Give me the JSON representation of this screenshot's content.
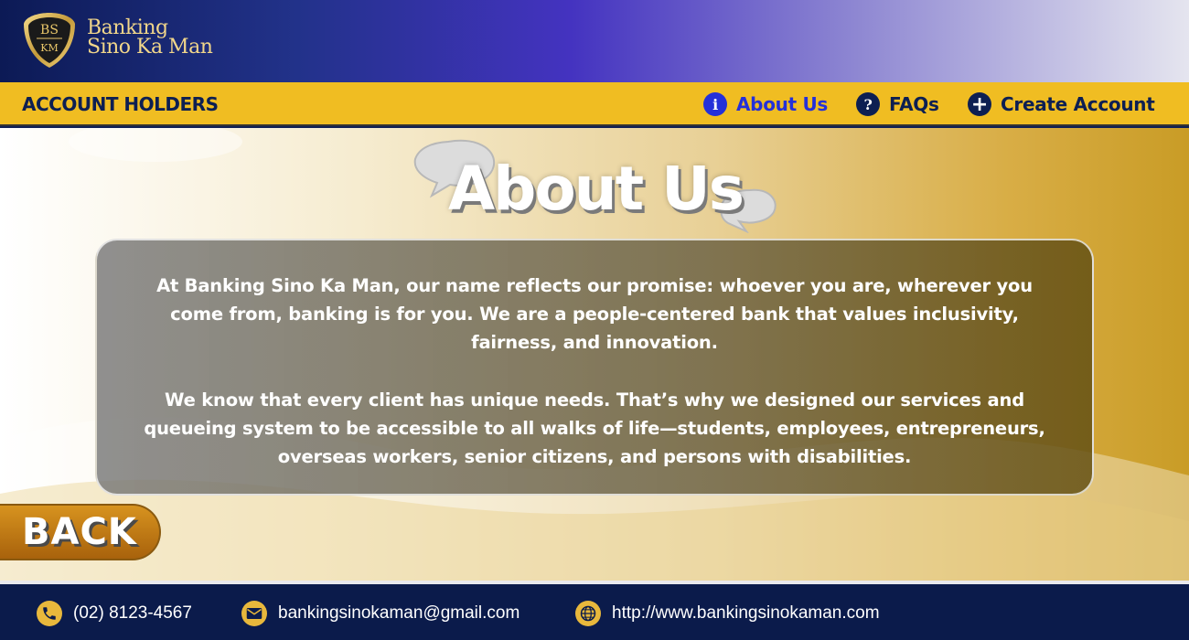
{
  "header": {
    "logo_initials_top": "BS",
    "logo_initials_bottom": "KM",
    "brand_line1": "Banking",
    "brand_line2": "Sino Ka Man"
  },
  "navbar": {
    "section_title": "ACCOUNT HOLDERS",
    "items": [
      {
        "label": "About Us",
        "icon": "info-icon",
        "active": true
      },
      {
        "label": "FAQs",
        "icon": "question-icon",
        "active": false
      },
      {
        "label": "Create Account",
        "icon": "plus-icon",
        "active": false
      }
    ]
  },
  "main": {
    "title": "About Us",
    "paragraphs": [
      "At Banking Sino Ka Man, our name reflects our promise: whoever you are, wherever you come from, banking is for you. We are a people-centered bank that values inclusivity, fairness, and innovation.",
      "We know that every client has unique needs. That’s why we designed our services and queueing system to be accessible to all walks of life—students, employees, entrepreneurs, overseas workers, senior citizens, and persons with disabilities."
    ],
    "back_label": "BACK"
  },
  "footer": {
    "phone": "(02) 8123-4567",
    "email": "bankingsinokaman@gmail.com",
    "website": "http://www.bankingsinokaman.com"
  },
  "colors": {
    "header_dark": "#0c1a55",
    "header_violet": "#4433c0",
    "navbar": "#f0bd22",
    "nav_text": "#0d1f52",
    "nav_active": "#2430d9",
    "back_button": "#c57d17",
    "footer": "#0b1b4b",
    "footer_icon": "#e8b83c",
    "logo_gold": "#f1d68a"
  }
}
